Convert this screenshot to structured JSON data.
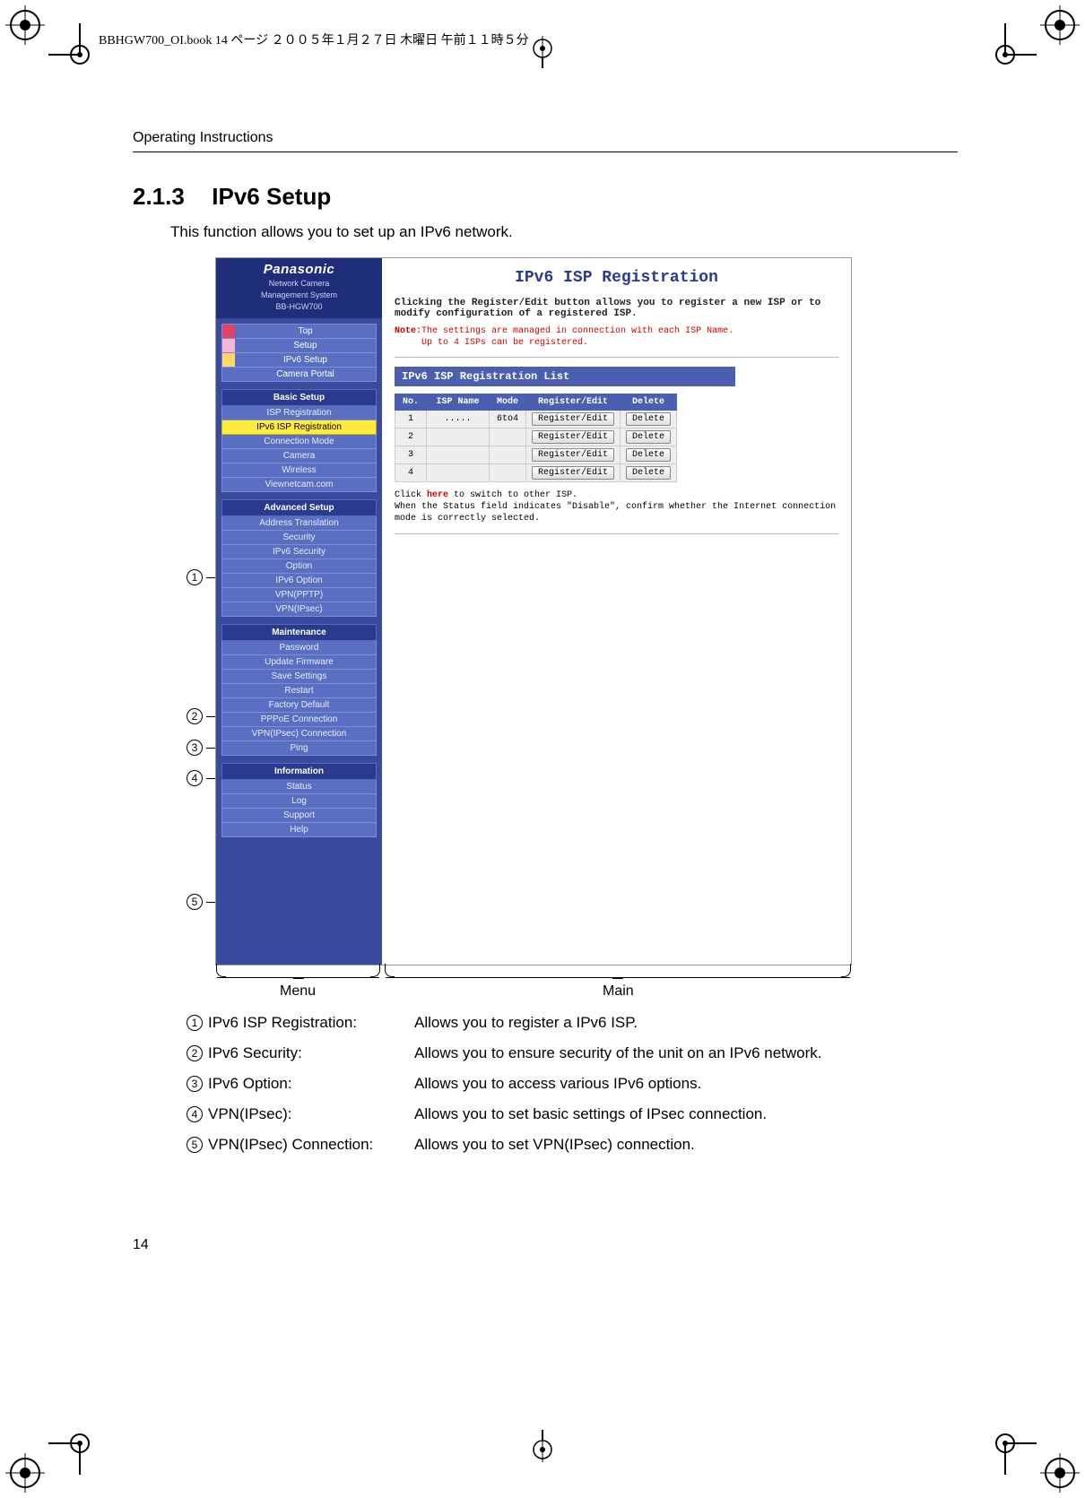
{
  "book_header": "BBHGW700_OI.book  14 ページ  ２００５年１月２７日  木曜日  午前１１時５分",
  "running_head": "Operating Instructions",
  "section_number": "2.1.3",
  "section_title": "IPv6 Setup",
  "lead_text": "This function allows you to set up an IPv6 network.",
  "page_number": "14",
  "brace_labels": {
    "menu": "Menu",
    "main": "Main"
  },
  "callout_numbers": [
    "1",
    "2",
    "3",
    "4",
    "5"
  ],
  "legend": [
    {
      "n": "1",
      "term": "IPv6 ISP Registration:",
      "desc": "Allows you to register a IPv6 ISP."
    },
    {
      "n": "2",
      "term": "IPv6 Security:",
      "desc": "Allows you to ensure security of the unit on an IPv6 network."
    },
    {
      "n": "3",
      "term": "IPv6 Option:",
      "desc": "Allows you to access various IPv6 options."
    },
    {
      "n": "4",
      "term": "VPN(IPsec):",
      "desc": "Allows you to set basic settings of IPsec connection."
    },
    {
      "n": "5",
      "term": "VPN(IPsec) Connection:",
      "desc": "Allows you to set VPN(IPsec) connection."
    }
  ],
  "menu": {
    "brand": "Panasonic",
    "brand_sub1": "Network Camera",
    "brand_sub2": "Management System",
    "brand_sub3": "BB-HGW700",
    "top_items": [
      "Top",
      "Setup",
      "IPv6 Setup",
      "Camera Portal"
    ],
    "groups": [
      {
        "title": "Basic Setup",
        "items": [
          "ISP Registration",
          "IPv6 ISP Registration",
          "Connection Mode",
          "Camera",
          "Wireless",
          "Viewnetcam.com"
        ],
        "highlight_index": 1
      },
      {
        "title": "Advanced Setup",
        "items": [
          "Address Translation",
          "Security",
          "IPv6 Security",
          "Option",
          "IPv6 Option",
          "VPN(PPTP)",
          "VPN(IPsec)"
        ]
      },
      {
        "title": "Maintenance",
        "items": [
          "Password",
          "Update Firmware",
          "Save Settings",
          "Restart",
          "Factory Default",
          "PPPoE Connection",
          "VPN(IPsec) Connection",
          "Ping"
        ]
      },
      {
        "title": "Information",
        "items": [
          "Status",
          "Log",
          "Support",
          "Help"
        ]
      }
    ]
  },
  "main": {
    "title": "IPv6 ISP Registration",
    "desc": "Clicking the Register/Edit button allows you to register a new ISP or to modify configuration of a registered ISP.",
    "note_label": "Note:",
    "note1": "The settings are managed in connection with each ISP Name.",
    "note2": "Up to 4 ISPs can be registered.",
    "list_title": "IPv6 ISP Registration List",
    "table": {
      "headers": [
        "No.",
        "ISP Name",
        "Mode",
        "Register/Edit",
        "Delete"
      ],
      "rows": [
        {
          "no": "1",
          "name": ".....",
          "mode": "6to4",
          "reg": "Register/Edit",
          "del": "Delete"
        },
        {
          "no": "2",
          "name": "",
          "mode": "",
          "reg": "Register/Edit",
          "del": "Delete"
        },
        {
          "no": "3",
          "name": "",
          "mode": "",
          "reg": "Register/Edit",
          "del": "Delete"
        },
        {
          "no": "4",
          "name": "",
          "mode": "",
          "reg": "Register/Edit",
          "del": "Delete"
        }
      ]
    },
    "foot_prefix": "Click ",
    "foot_here": "here",
    "foot_rest": " to switch to other ISP.",
    "foot_line2": "When the Status field indicates \"Disable\", confirm whether the Internet connection mode is correctly selected."
  },
  "chart_data": {
    "type": "table",
    "title": "IPv6 ISP Registration List",
    "columns": [
      "No.",
      "ISP Name",
      "Mode",
      "Register/Edit",
      "Delete"
    ],
    "rows": [
      [
        "1",
        ".....",
        "6to4",
        "Register/Edit",
        "Delete"
      ],
      [
        "2",
        "",
        "",
        "Register/Edit",
        "Delete"
      ],
      [
        "3",
        "",
        "",
        "Register/Edit",
        "Delete"
      ],
      [
        "4",
        "",
        "",
        "Register/Edit",
        "Delete"
      ]
    ]
  }
}
